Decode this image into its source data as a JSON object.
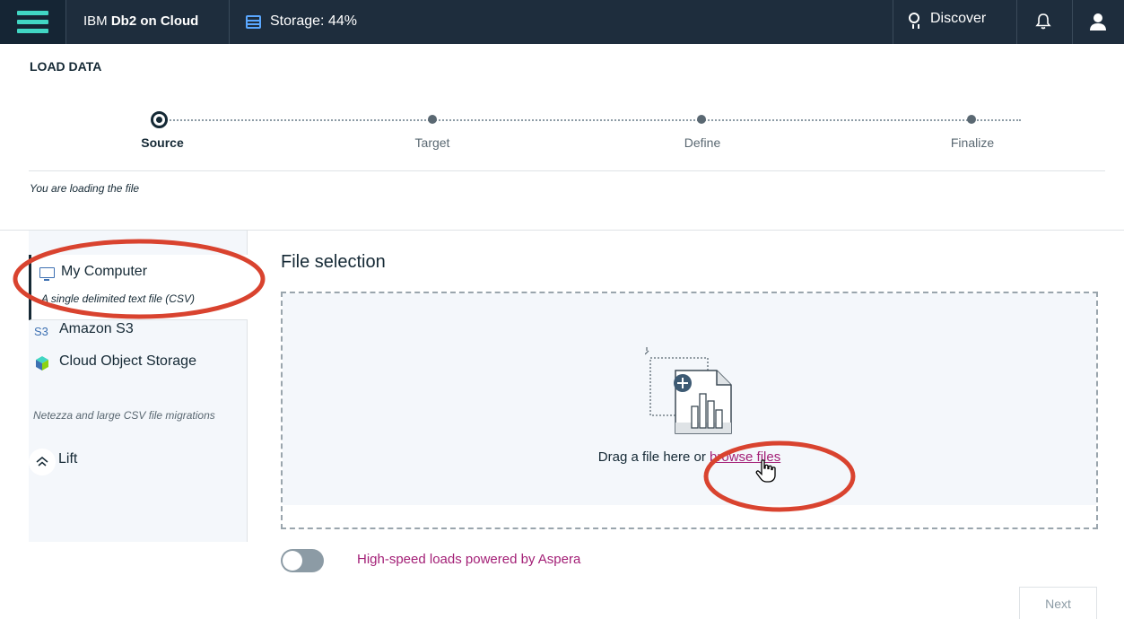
{
  "topbar": {
    "brand_prefix": "IBM ",
    "brand_name": "Db2 on Cloud",
    "storage_label": "Storage: 44%",
    "storage_percent": 44,
    "discover_label": "Discover",
    "icons": [
      "menu-icon",
      "storage-icon",
      "lightbulb-icon",
      "bell-icon",
      "user-icon"
    ]
  },
  "page": {
    "title": "LOAD DATA",
    "loading_text": "You are loading the file"
  },
  "steps": [
    {
      "label": "Source",
      "active": true
    },
    {
      "label": "Target",
      "active": false
    },
    {
      "label": "Define",
      "active": false
    },
    {
      "label": "Finalize",
      "active": false
    }
  ],
  "sources": {
    "my_computer": {
      "label": "My Computer",
      "description": "A single delimited text file (CSV)",
      "icon": "monitor-icon",
      "selected": true
    },
    "amazon_s3": {
      "label": "Amazon S3",
      "icon_text": "S3"
    },
    "cloud_object_storage": {
      "label": "Cloud Object Storage",
      "icon": "cube-icon"
    },
    "migration_note": "Netezza and large CSV file migrations",
    "lift": {
      "label": "Lift",
      "icon": "chevron-up-double-icon"
    }
  },
  "file_selection": {
    "title": "File selection",
    "drop_prefix": "Drag a file here or ",
    "browse_link": "browse files"
  },
  "aspera": {
    "toggle_on": false,
    "label": "High-speed loads powered by Aspera"
  },
  "actions": {
    "next_label": "Next"
  },
  "colors": {
    "topbar": "#1e2d3d",
    "accent_teal": "#41d6c3",
    "link_magenta": "#a31f76",
    "annotation_red": "#e8513e"
  }
}
